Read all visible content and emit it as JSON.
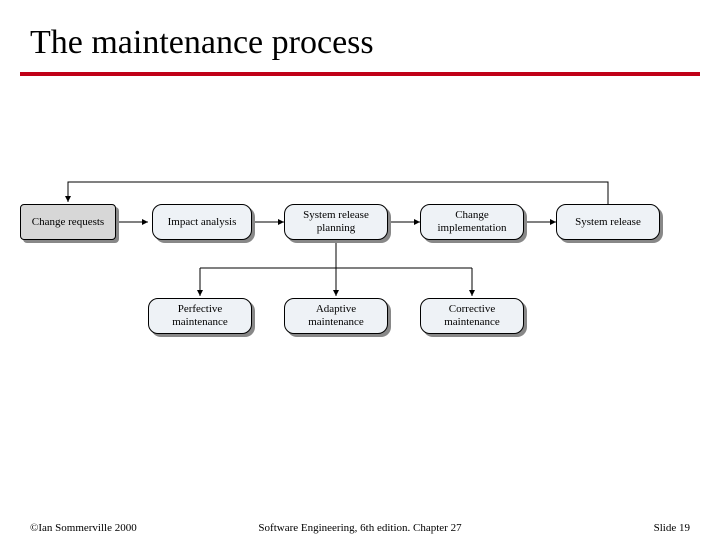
{
  "title": "The maintenance process",
  "footer": {
    "copyright": "©Ian Sommerville 2000",
    "center": "Software Engineering, 6th edition. Chapter 27",
    "slide": "Slide 19"
  },
  "diagram": {
    "nodes": {
      "change_requests": "Change\nrequests",
      "impact_analysis": "Impact\nanalysis",
      "release_planning": "System release\nplanning",
      "change_implementation": "Change\nimplementation",
      "system_release": "System\nrelease",
      "perfective": "Perfective\nmaintenance",
      "adaptive": "Adaptive\nmaintenance",
      "corrective": "Corrective\nmaintenance"
    }
  }
}
